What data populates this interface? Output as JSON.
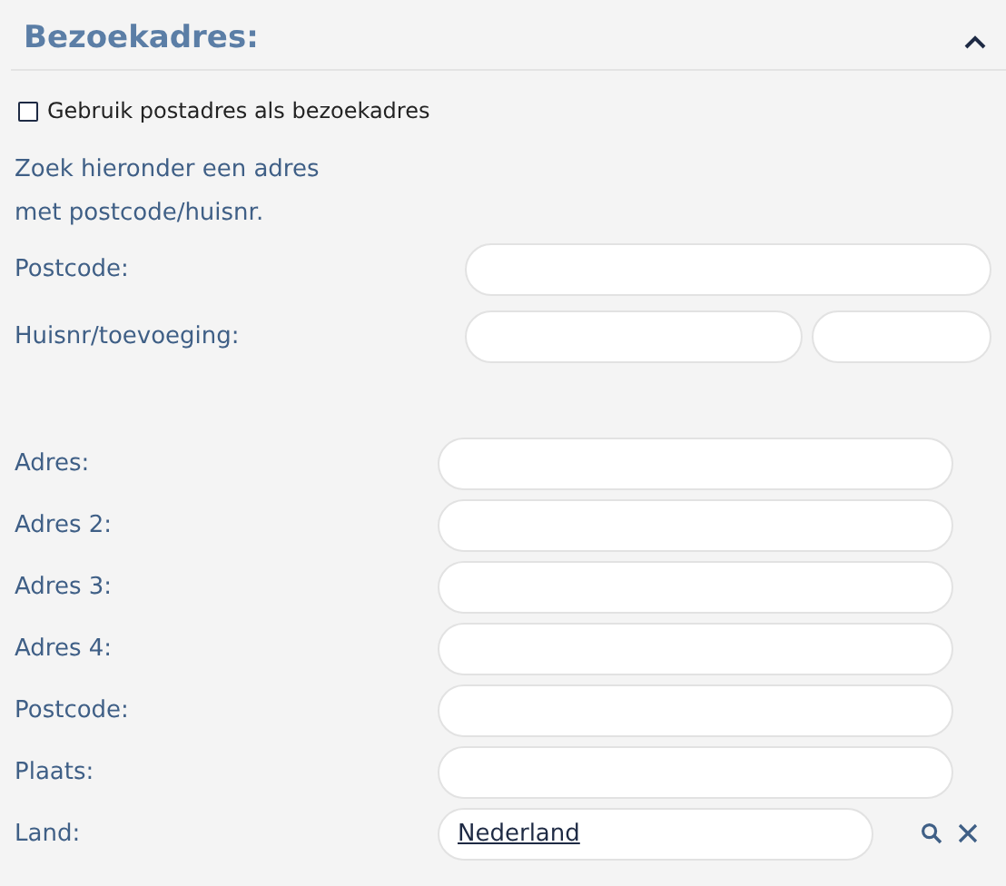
{
  "section": {
    "title": "Bezoekadres:",
    "expanded": true
  },
  "use_postal_address": {
    "label": "Gebruik postadres als bezoekadres",
    "checked": false
  },
  "hint": [
    "Zoek hieronder een adres",
    "met postcode/huisnr."
  ],
  "lookup_fields": [
    {
      "label": "Postcode:",
      "kind": "single"
    },
    {
      "label": "Huisnr/toevoeging:",
      "kind": "split"
    }
  ],
  "address_fields": [
    {
      "label": "Adres:",
      "kind": "text"
    },
    {
      "label": "Adres 2:",
      "kind": "text"
    },
    {
      "label": "Adres 3:",
      "kind": "text"
    },
    {
      "label": "Adres 4:",
      "kind": "text"
    },
    {
      "label": "Postcode:",
      "kind": "text"
    },
    {
      "label": "Plaats:",
      "kind": "text"
    },
    {
      "label": "Land:",
      "kind": "lookup",
      "value": "Nederland"
    }
  ]
}
